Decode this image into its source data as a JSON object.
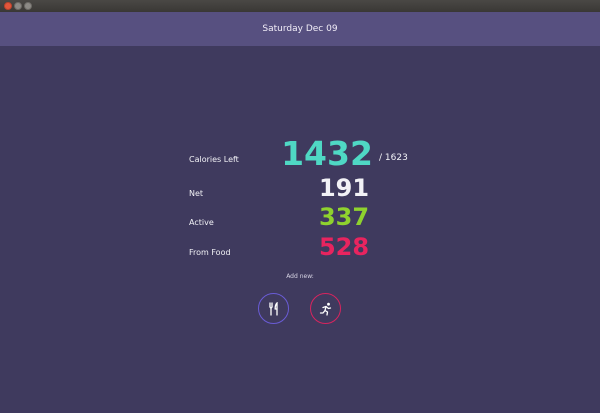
{
  "header": {
    "date": "Saturday Dec 09"
  },
  "summary": {
    "calories_left_label": "Calories Left",
    "calories_left_value": "1432",
    "goal": "/ 1623",
    "net_label": "Net",
    "net_value": "191",
    "active_label": "Active",
    "active_value": "337",
    "food_label": "From Food",
    "food_value": "528"
  },
  "add_new": {
    "label": "Add new:"
  },
  "colors": {
    "background": "#3f3a5e",
    "header": "#575080",
    "calories_left": "#4fd8c4",
    "net": "#f2f2f6",
    "active": "#8fd22e",
    "food": "#e8245f",
    "food_button_ring": "#6a5cd6",
    "activity_button_ring": "#d8245e"
  },
  "icons": {
    "food_button": "fork-knife-icon",
    "activity_button": "running-person-icon"
  }
}
